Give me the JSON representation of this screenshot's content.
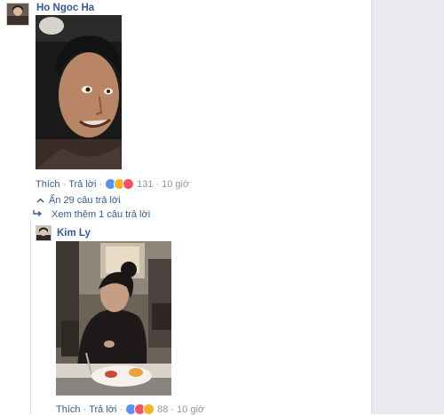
{
  "comment1": {
    "author": "Ho Ngoc Ha",
    "actions": {
      "like": "Thích",
      "reply": "Trả lời",
      "reaction_count": "131",
      "time": "10 giờ"
    }
  },
  "thread": {
    "hide_replies": "Ẩn 29 câu trả lời",
    "more_replies": "Xem thêm 1 câu trả lời"
  },
  "reply1": {
    "author": "Kim Ly",
    "actions": {
      "like": "Thích",
      "reply": "Trả lời",
      "reaction_count": "88",
      "time": "10 giờ"
    }
  },
  "icons": [
    "chevron-up-icon",
    "reply-arrow-icon",
    "like-reaction-icon",
    "haha-reaction-icon",
    "love-reaction-icon"
  ],
  "colors": {
    "link": "#365899",
    "meta": "#90949c",
    "gutter": "#e9ebee"
  }
}
